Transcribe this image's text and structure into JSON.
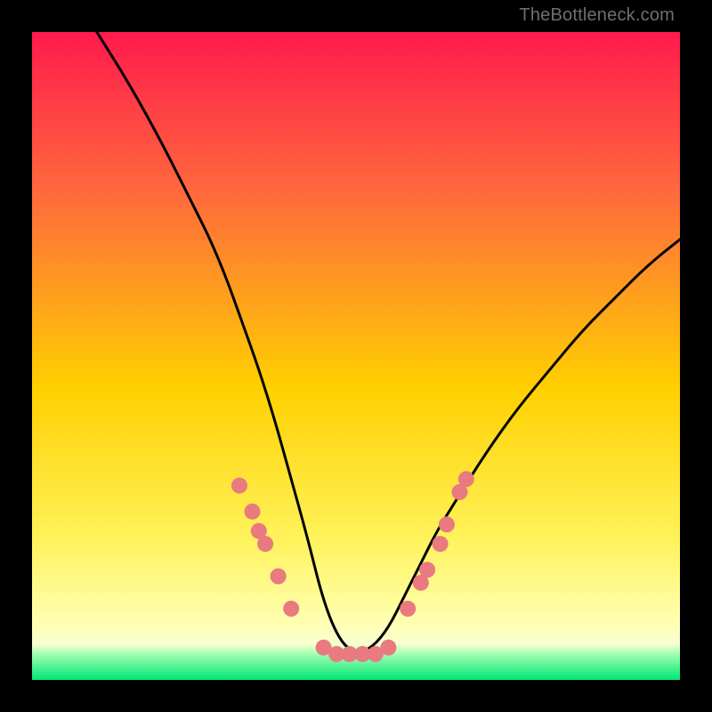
{
  "watermark": "TheBottleneck.com",
  "chart_data": {
    "type": "line",
    "title": "",
    "xlabel": "",
    "ylabel": "",
    "xlim": [
      0,
      100
    ],
    "ylim": [
      0,
      100
    ],
    "background": {
      "top_color": "#ff1a4d",
      "mid_color": "#ffe000",
      "bottom_color": "#00e676",
      "bottom_band_start": 94
    },
    "curve": {
      "description": "V-shaped bottleneck curve; steep descent from top-left to x≈45, flat minimum from x≈45 to x≈55, moderate ascent to upper right",
      "x": [
        10,
        15,
        20,
        25,
        27.5,
        30,
        32.5,
        35,
        37.5,
        40,
        42.5,
        45,
        47.5,
        50,
        52.5,
        55,
        57.5,
        60,
        62.5,
        65,
        70,
        75,
        80,
        85,
        90,
        95,
        100
      ],
      "y": [
        100,
        92,
        83,
        73,
        68,
        62,
        55,
        48,
        40,
        31,
        22,
        12,
        6,
        4,
        5,
        8,
        13,
        18,
        23,
        27,
        35,
        42,
        48,
        54,
        59,
        64,
        68
      ]
    },
    "markers": {
      "description": "Pink circular data-point markers clustered along the lower V section",
      "color": "#e87a80",
      "points": [
        {
          "x": 32,
          "y": 30
        },
        {
          "x": 34,
          "y": 26
        },
        {
          "x": 35,
          "y": 23
        },
        {
          "x": 36,
          "y": 21
        },
        {
          "x": 38,
          "y": 16
        },
        {
          "x": 40,
          "y": 11
        },
        {
          "x": 45,
          "y": 5
        },
        {
          "x": 47,
          "y": 4
        },
        {
          "x": 49,
          "y": 4
        },
        {
          "x": 51,
          "y": 4
        },
        {
          "x": 53,
          "y": 4
        },
        {
          "x": 55,
          "y": 5
        },
        {
          "x": 58,
          "y": 11
        },
        {
          "x": 60,
          "y": 15
        },
        {
          "x": 61,
          "y": 17
        },
        {
          "x": 63,
          "y": 21
        },
        {
          "x": 64,
          "y": 24
        },
        {
          "x": 66,
          "y": 29
        },
        {
          "x": 67,
          "y": 31
        }
      ]
    }
  }
}
